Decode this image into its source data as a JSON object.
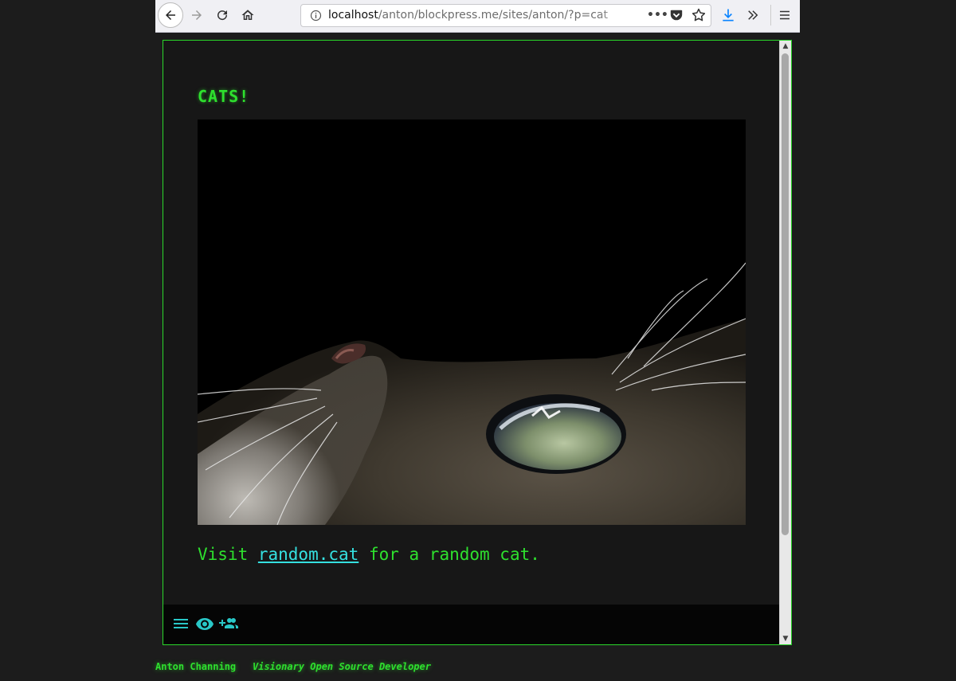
{
  "browser": {
    "url_host": "localhost",
    "url_path": "/anton/blockpress.me/sites/anton/?p=cat",
    "page_actions_label": "•••"
  },
  "post": {
    "title": "CATS!",
    "text_before": "Visit ",
    "link_text": "random.cat",
    "text_after": " for a random cat."
  },
  "icons": {
    "toolbar": [
      "back-icon",
      "forward-icon",
      "reload-icon",
      "home-icon",
      "info-icon",
      "pocket-icon",
      "star-icon",
      "download-icon",
      "overflow-icon",
      "menu-icon"
    ],
    "bottom_bar": [
      "menu-icon",
      "eye-icon",
      "group-add-icon"
    ]
  },
  "footer": {
    "name": "Anton Channing",
    "tagline": "Visionary Open Source Developer"
  },
  "colors": {
    "accent_green": "#2ee02e",
    "link_cyan": "#35e0e0",
    "icon_teal": "#29c7c7",
    "background": "#171717"
  }
}
